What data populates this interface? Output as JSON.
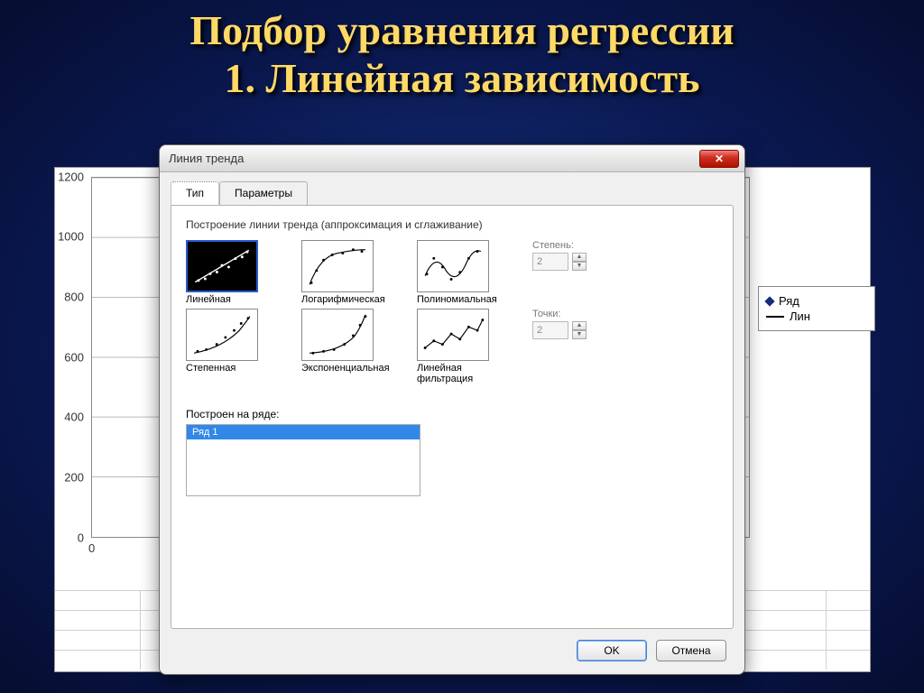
{
  "slide": {
    "title_line1": "Подбор  уравнения регрессии",
    "title_line2": "1. Линейная зависимость"
  },
  "chart": {
    "y_ticks": [
      "0",
      "200",
      "400",
      "600",
      "800",
      "1000",
      "1200"
    ],
    "x_tick0": "0",
    "legend_series": "Ряд",
    "legend_line": "Лин"
  },
  "dialog": {
    "title": "Линия тренда",
    "tabs": {
      "type": "Тип",
      "params": "Параметры"
    },
    "group": "Построение линии тренда (аппроксимация и сглаживание)",
    "types": {
      "linear": "Линейная",
      "log": "Логарифмическая",
      "poly": "Полиномиальная",
      "power": "Степенная",
      "exp": "Экспоненциальная",
      "movavg": "Линейная фильтрация"
    },
    "degree_label": "Степень:",
    "degree_value": "2",
    "points_label": "Точки:",
    "points_value": "2",
    "series_label": "Построен на ряде:",
    "series_item": "Ряд 1",
    "ok": "OK",
    "cancel": "Отмена"
  }
}
